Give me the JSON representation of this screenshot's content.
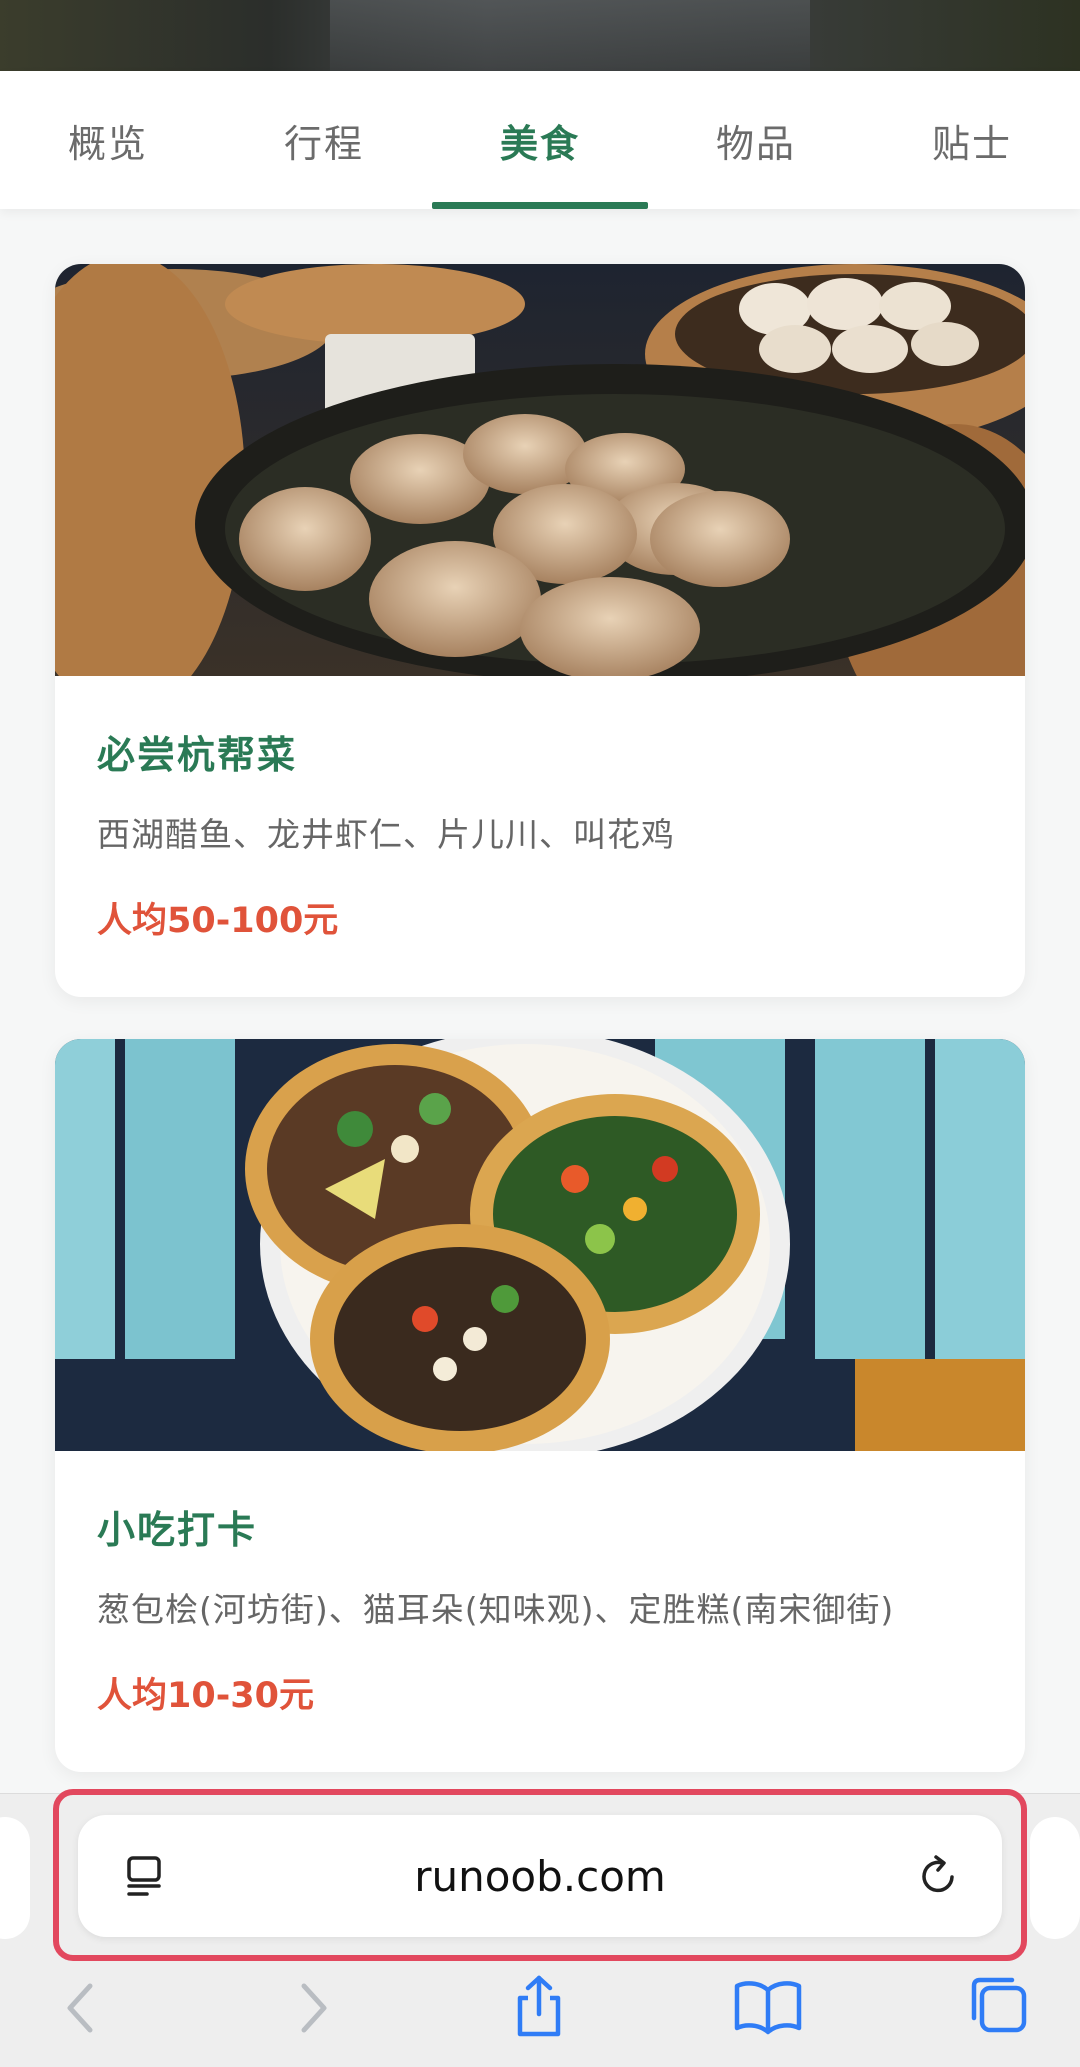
{
  "tabs": [
    {
      "label": "概览",
      "active": false
    },
    {
      "label": "行程",
      "active": false
    },
    {
      "label": "美食",
      "active": true
    },
    {
      "label": "物品",
      "active": false
    },
    {
      "label": "贴士",
      "active": false
    }
  ],
  "cards": [
    {
      "title": "必尝杭帮菜",
      "desc": "西湖醋鱼、龙井虾仁、片儿川、叫花鸡",
      "price": "人均50-100元",
      "image": "dumplings-photo"
    },
    {
      "title": "小吃打卡",
      "desc": "葱包桧(河坊街)、猫耳朵(知味观)、定胜糕(南宋御街)",
      "price": "人均10-30元",
      "image": "tacos-photo"
    }
  ],
  "browser": {
    "url": "runoob.com",
    "left_icon": "reader-icon",
    "right_icon": "reload-icon",
    "toolbar": [
      "back-icon",
      "forward-icon",
      "share-icon",
      "bookmarks-icon",
      "tabs-icon"
    ]
  },
  "colors": {
    "accent": "#2a7a55",
    "price": "#e0533a",
    "highlight_frame": "#e2485e"
  }
}
